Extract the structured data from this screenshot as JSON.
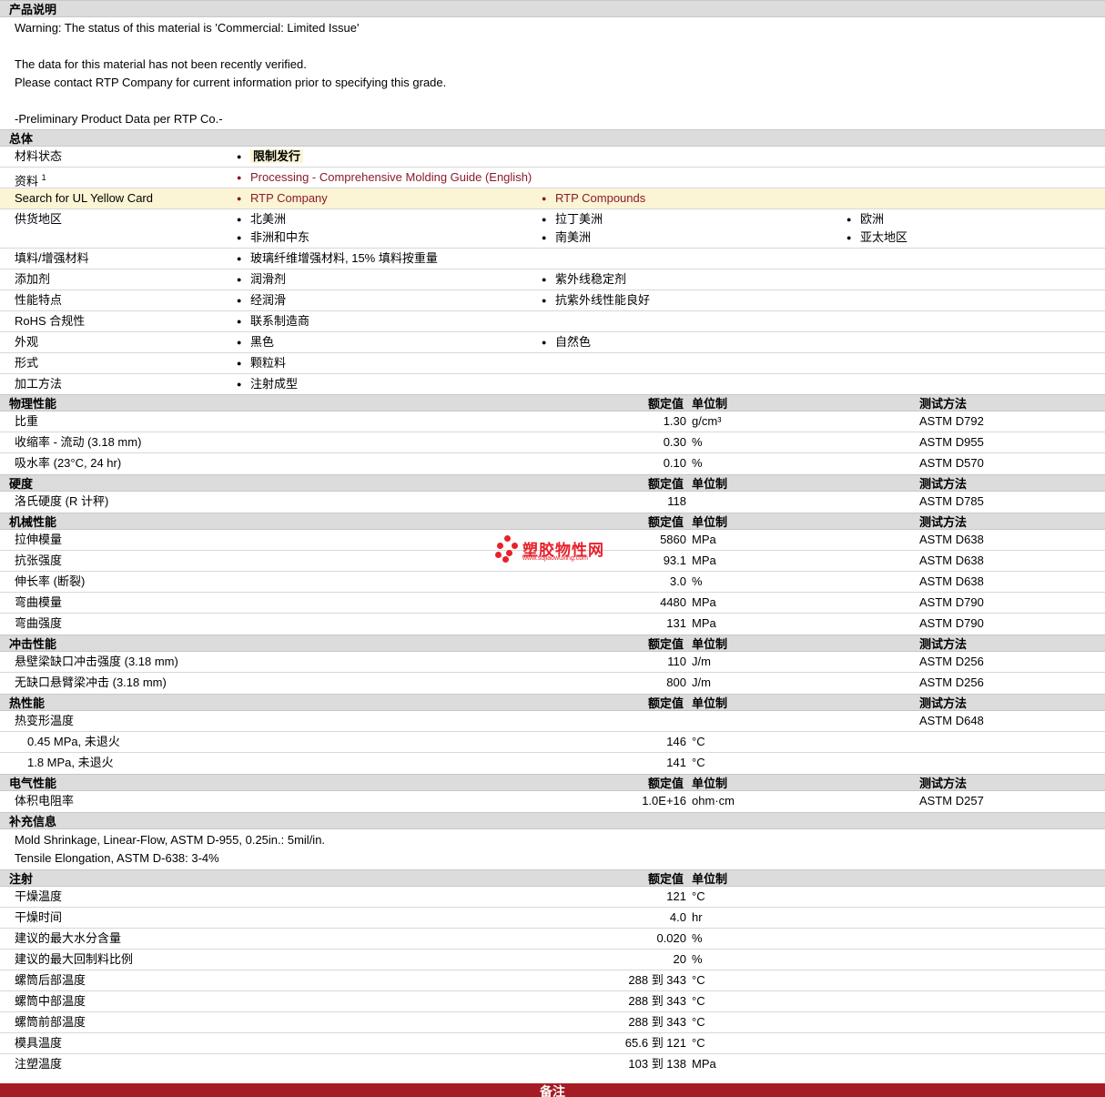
{
  "desc": {
    "title": "产品说明",
    "lines": [
      "Warning: The status of this material is 'Commercial: Limited Issue'",
      "",
      "The data for this material has not been recently verified.",
      "Please contact RTP Company for current information prior to specifying this grade.",
      "",
      "-Preliminary Product Data per RTP Co.-"
    ]
  },
  "general": {
    "title": "总体",
    "status_label": "材料状态",
    "status_value": "限制发行",
    "docs_label": "资料",
    "docs_sup": "1",
    "docs_link": "Processing - Comprehensive Molding Guide (English)",
    "ul_label": "Search for UL Yellow Card",
    "ul_link1": "RTP Company",
    "ul_link2": "RTP Compounds",
    "supply_label": "供货地区",
    "supply": [
      "北美洲",
      "拉丁美洲",
      "欧洲",
      "非洲和中东",
      "南美洲",
      "亚太地区"
    ],
    "filler_label": "填料/增强材料",
    "filler": "玻璃纤维增强材料, 15% 填料按重量",
    "additive_label": "添加剂",
    "additives": [
      "润滑剂",
      "紫外线稳定剂"
    ],
    "feature_label": "性能特点",
    "features": [
      "经润滑",
      "抗紫外线性能良好"
    ],
    "rohs_label": "RoHS 合规性",
    "rohs": "联系制造商",
    "appearance_label": "外观",
    "appearance": [
      "黑色",
      "自然色"
    ],
    "form_label": "形式",
    "form": "颗粒料",
    "process_label": "加工方法",
    "process": "注射成型"
  },
  "headers": {
    "value": "额定值",
    "unit": "单位制",
    "method": "测试方法"
  },
  "physical": {
    "title": "物理性能",
    "rows": [
      {
        "label": "比重",
        "value": "1.30",
        "unit": "g/cm³",
        "method": "ASTM D792"
      },
      {
        "label": "收缩率  - 流动  (3.18 mm)",
        "value": "0.30",
        "unit": "%",
        "method": "ASTM D955"
      },
      {
        "label": "吸水率  (23°C, 24 hr)",
        "value": "0.10",
        "unit": "%",
        "method": "ASTM D570"
      }
    ]
  },
  "hardness": {
    "title": "硬度",
    "rows": [
      {
        "label": "洛氏硬度  (R 计秤)",
        "value": "118",
        "unit": "",
        "method": "ASTM D785"
      }
    ]
  },
  "mechanical": {
    "title": "机械性能",
    "rows": [
      {
        "label": "拉伸模量",
        "value": "5860",
        "unit": "MPa",
        "method": "ASTM D638"
      },
      {
        "label": "抗张强度",
        "value": "93.1",
        "unit": "MPa",
        "method": "ASTM D638"
      },
      {
        "label": "伸长率  (断裂)",
        "value": "3.0",
        "unit": "%",
        "method": "ASTM D638"
      },
      {
        "label": "弯曲模量",
        "value": "4480",
        "unit": "MPa",
        "method": "ASTM D790"
      },
      {
        "label": "弯曲强度",
        "value": "131",
        "unit": "MPa",
        "method": "ASTM D790"
      }
    ]
  },
  "impact": {
    "title": "冲击性能",
    "rows": [
      {
        "label": "悬壁梁缺口冲击强度  (3.18 mm)",
        "value": "110",
        "unit": "J/m",
        "method": "ASTM D256"
      },
      {
        "label": "无缺口悬臂梁冲击  (3.18 mm)",
        "value": "800",
        "unit": "J/m",
        "method": "ASTM D256"
      }
    ]
  },
  "thermal": {
    "title": "热性能",
    "rows": [
      {
        "label": "热变形温度",
        "value": "",
        "unit": "",
        "method": "ASTM D648"
      },
      {
        "label": "0.45 MPa, 未退火",
        "value": "146",
        "unit": "°C",
        "method": "",
        "sub": true
      },
      {
        "label": "1.8 MPa, 未退火",
        "value": "141",
        "unit": "°C",
        "method": "",
        "sub": true
      }
    ]
  },
  "electrical": {
    "title": "电气性能",
    "rows": [
      {
        "label": "体积电阻率",
        "value": "1.0E+16",
        "unit": "ohm·cm",
        "method": "ASTM D257"
      }
    ]
  },
  "supplement": {
    "title": "补充信息",
    "lines": [
      "Mold Shrinkage, Linear-Flow, ASTM D-955, 0.25in.: 5mil/in.",
      "Tensile Elongation, ASTM D-638: 3-4%"
    ]
  },
  "injection": {
    "title": "注射",
    "rows": [
      {
        "label": "干燥温度",
        "value": "121",
        "unit": "°C"
      },
      {
        "label": "干燥时间",
        "value": "4.0",
        "unit": "hr"
      },
      {
        "label": "建议的最大水分含量",
        "value": "0.020",
        "unit": "%"
      },
      {
        "label": "建议的最大回制料比例",
        "value": "20",
        "unit": "%"
      },
      {
        "label": "螺筒后部温度",
        "value": "288 到  343",
        "unit": "°C"
      },
      {
        "label": "螺筒中部温度",
        "value": "288 到  343",
        "unit": "°C"
      },
      {
        "label": "螺筒前部温度",
        "value": "288 到  343",
        "unit": "°C"
      },
      {
        "label": "模具温度",
        "value": "65.6 到  121",
        "unit": "°C"
      },
      {
        "label": "注塑温度",
        "value": "103 到  138",
        "unit": "MPa"
      }
    ]
  },
  "footer": {
    "title": "备注"
  },
  "watermark": {
    "name": "塑胶物性网",
    "url": "www.sujiaowuxing.com",
    "color": "#e8202a"
  }
}
